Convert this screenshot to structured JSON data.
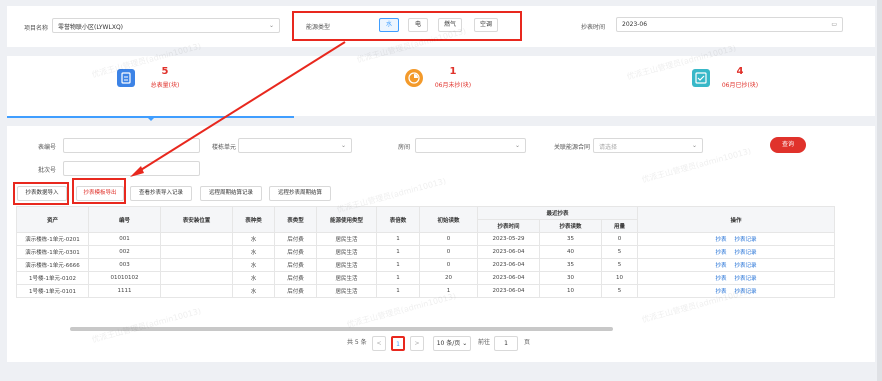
{
  "filter": {
    "project_label": "项目名称",
    "project_value": "零誉物联小区(LYWLXQ)",
    "energy_label": "能源类型",
    "energy_types": [
      "水",
      "电",
      "燃气",
      "空调"
    ],
    "meter_time_label": "抄表时间",
    "meter_time_value": "2023-06"
  },
  "stats": {
    "total_num": "5",
    "total_label": "总表量(块)",
    "unread_num": "1",
    "unread_label": "06月未抄(块)",
    "read_num": "4",
    "read_label": "06月已抄(块)"
  },
  "search": {
    "meter_no_label": "表编号",
    "unit_label": "楼栋单元",
    "room_label": "房间",
    "contract_label": "关联能源合同",
    "contract_placeholder": "请选择",
    "batch_label": "批次号",
    "query_button": "查询"
  },
  "actions": [
    "抄表数据导入",
    "抄表模板导出",
    "查看抄表导入记录",
    "远程周期结算记录",
    "远程抄表周期结算"
  ],
  "table": {
    "headers": {
      "asset": "资产",
      "number": "编号",
      "location": "表安装位置",
      "meter_kind": "表种类",
      "meter_type": "表类型",
      "usage_type": "能源使用类型",
      "multiplier": "表倍数",
      "initial": "初始读数",
      "latest": "最近抄表",
      "latest_time": "抄表时间",
      "latest_reading": "抄表读数",
      "usage": "用量",
      "ops": "操作"
    },
    "rows": [
      {
        "asset": "演示楼栋-1单元-0201",
        "number": "001",
        "location": "",
        "kind": "水",
        "type": "后付费",
        "usage_type": "居民生活",
        "multiplier": "1",
        "initial": "0",
        "time": "2023-05-29",
        "reading": "35",
        "usage": "0"
      },
      {
        "asset": "演示楼栋-1单元-0301",
        "number": "002",
        "location": "",
        "kind": "水",
        "type": "后付费",
        "usage_type": "居民生活",
        "multiplier": "1",
        "initial": "0",
        "time": "2023-06-04",
        "reading": "40",
        "usage": "5"
      },
      {
        "asset": "演示楼栋-1单元-6666",
        "number": "003",
        "location": "",
        "kind": "水",
        "type": "后付费",
        "usage_type": "居民生活",
        "multiplier": "1",
        "initial": "0",
        "time": "2023-06-04",
        "reading": "35",
        "usage": "5"
      },
      {
        "asset": "1号楼-1单元-0102",
        "number": "01010102",
        "location": "",
        "kind": "水",
        "type": "后付费",
        "usage_type": "居民生活",
        "multiplier": "1",
        "initial": "20",
        "time": "2023-06-04",
        "reading": "30",
        "usage": "10"
      },
      {
        "asset": "1号楼-1单元-0101",
        "number": "1111",
        "location": "",
        "kind": "水",
        "type": "后付费",
        "usage_type": "居民生活",
        "multiplier": "1",
        "initial": "1",
        "time": "2023-06-04",
        "reading": "10",
        "usage": "5"
      }
    ],
    "op_read": "抄表",
    "op_record": "抄表记录"
  },
  "pagination": {
    "total": "共 5 条",
    "prev": "<",
    "current": "1",
    "next": ">",
    "page_size": "10 条/页",
    "goto_label": "前往",
    "goto_value": "1",
    "page_suffix": "页"
  },
  "watermark": "优派王山管理员(admin10013)"
}
